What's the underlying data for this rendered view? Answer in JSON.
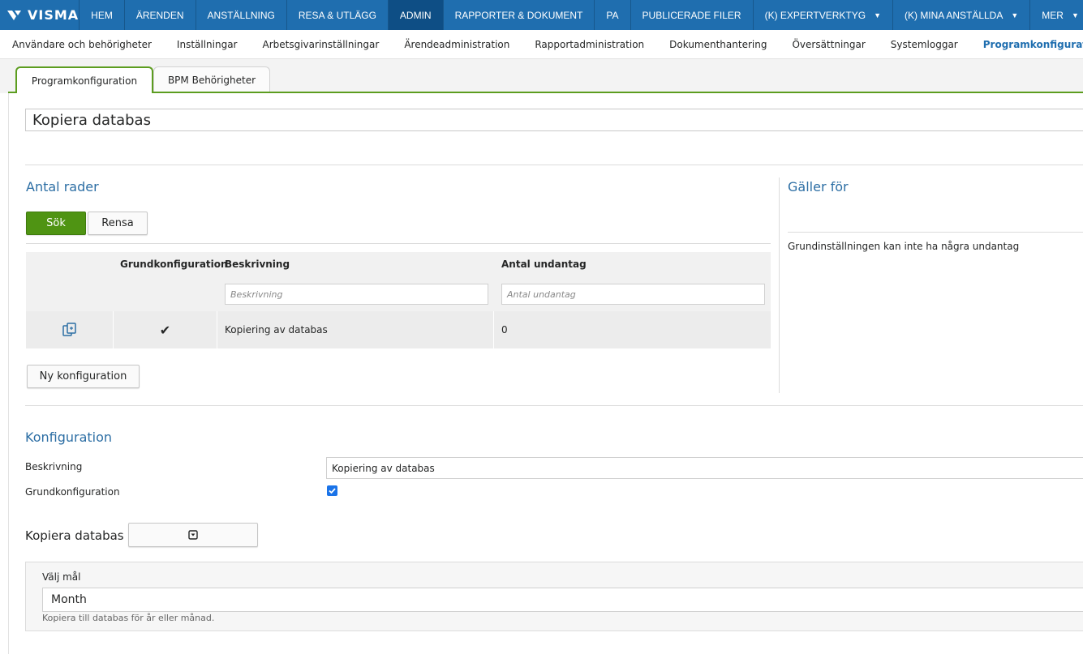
{
  "brand": "VISMA",
  "topnav": [
    {
      "label": "HEM",
      "active": false,
      "dropdown": false
    },
    {
      "label": "ÄRENDEN",
      "active": false,
      "dropdown": false
    },
    {
      "label": "ANSTÄLLNING",
      "active": false,
      "dropdown": false
    },
    {
      "label": "RESA & UTLÄGG",
      "active": false,
      "dropdown": false
    },
    {
      "label": "ADMIN",
      "active": true,
      "dropdown": false
    },
    {
      "label": "RAPPORTER & DOKUMENT",
      "active": false,
      "dropdown": false
    },
    {
      "label": "PA",
      "active": false,
      "dropdown": false
    },
    {
      "label": "PUBLICERADE FILER",
      "active": false,
      "dropdown": false
    },
    {
      "label": "(K) EXPERTVERKTYG",
      "active": false,
      "dropdown": true
    },
    {
      "label": "(K) MINA ANSTÄLLDA",
      "active": false,
      "dropdown": true
    },
    {
      "label": "MER",
      "active": false,
      "dropdown": true
    }
  ],
  "subnav": [
    {
      "label": "Användare och behörigheter",
      "active": false
    },
    {
      "label": "Inställningar",
      "active": false
    },
    {
      "label": "Arbetsgivarinställningar",
      "active": false
    },
    {
      "label": "Ärendeadministration",
      "active": false
    },
    {
      "label": "Rapportadministration",
      "active": false
    },
    {
      "label": "Dokumenthantering",
      "active": false
    },
    {
      "label": "Översättningar",
      "active": false
    },
    {
      "label": "Systemloggar",
      "active": false
    },
    {
      "label": "Programkonfiguration",
      "active": true
    }
  ],
  "tabs": [
    {
      "label": "Programkonfiguration",
      "active": true
    },
    {
      "label": "BPM Behörigheter",
      "active": false
    }
  ],
  "page_title": "Kopiera databas",
  "rows_section": {
    "heading": "Antal rader",
    "search_label": "Sök",
    "clear_label": "Rensa",
    "columns": [
      "",
      "Grundkonfiguration",
      "Beskrivning",
      "Antal undantag"
    ],
    "filters": {
      "beskrivning": "Beskrivning",
      "antal_undantag": "Antal undantag"
    },
    "rows": [
      {
        "grundkonfiguration": "✔",
        "beskrivning": "Kopiering av databas",
        "antal_undantag": "0"
      }
    ],
    "new_config_label": "Ny konfiguration"
  },
  "applies_section": {
    "heading": "Gäller för",
    "note": "Grundinställningen kan inte ha några undantag"
  },
  "config_section": {
    "heading": "Konfiguration",
    "description_label": "Beskrivning",
    "description_value": "Kopiering av databas",
    "base_config_label": "Grundkonfiguration",
    "base_config_checked": true,
    "copy_label": "Kopiera databas",
    "target_label": "Välj mål",
    "target_value": "Month",
    "target_help": "Kopiera till databas för år eller månad."
  },
  "colors": {
    "nav": "#1f6eaf",
    "nav_active": "#0e4e85",
    "accent_green": "#4f9413",
    "heading_blue": "#2c6ea4"
  }
}
